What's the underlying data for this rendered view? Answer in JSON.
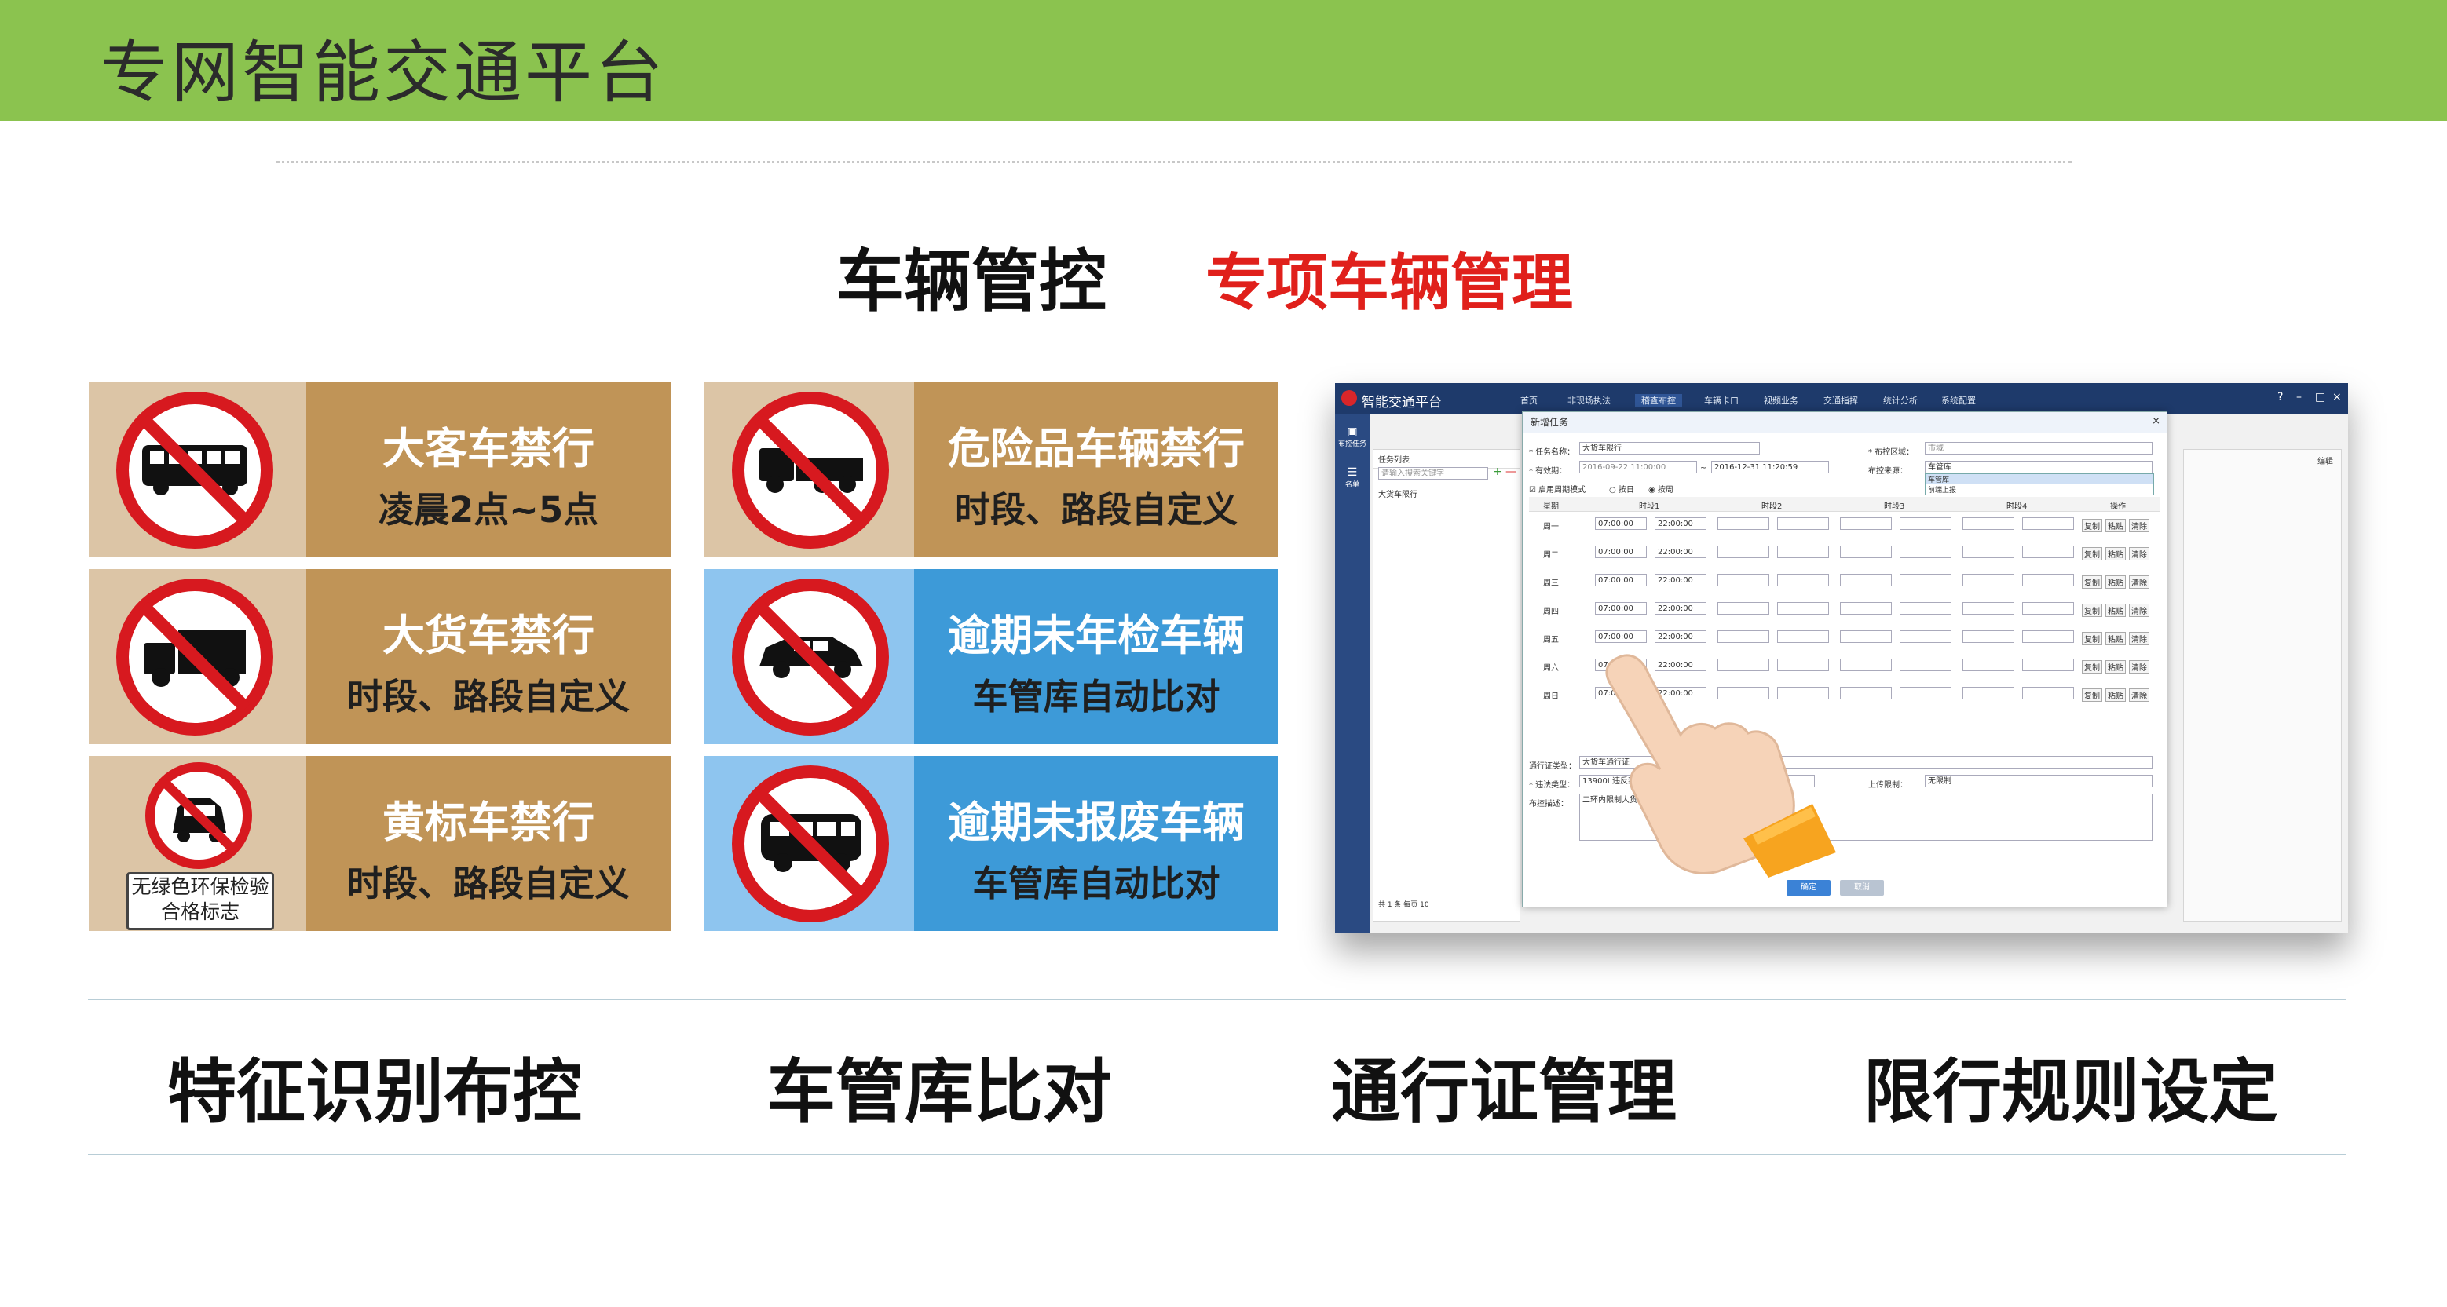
{
  "header": {
    "title": "专网智能交通平台",
    "bar_color": "#8bc34f"
  },
  "section": {
    "title": "车辆管控",
    "subtitle": "专项车辆管理",
    "subtitle_color": "#e0201b"
  },
  "cards": [
    {
      "icon": "no-bus-icon",
      "line1": "大客车禁行",
      "line2": "凌晨2点~5点",
      "theme": "brown"
    },
    {
      "icon": "no-hazmat-truck-icon",
      "line1": "危险品车辆禁行",
      "line2": "时段、路段自定义",
      "theme": "brown"
    },
    {
      "icon": "no-truck-icon",
      "line1": "大货车禁行",
      "line2": "时段、路段自定义",
      "theme": "brown"
    },
    {
      "icon": "no-overdue-inspection-car-icon",
      "line1": "逾期未年检车辆",
      "line2": "车管库自动比对",
      "theme": "blue"
    },
    {
      "icon": "no-yellow-label-car-icon",
      "line1": "黄标车禁行",
      "line2": "时段、路段自定义",
      "theme": "brown",
      "tag": "无绿色环保检验合格标志"
    },
    {
      "icon": "no-unscrapped-bus-icon",
      "line1": "逾期未报废车辆",
      "line2": "车管库自动比对",
      "theme": "blue"
    }
  ],
  "app": {
    "brand": "智能交通平台",
    "nav": [
      "首页",
      "非现场执法",
      "稽查布控",
      "车辆卡口",
      "视频业务",
      "交通指挥",
      "统计分析",
      "系统配置"
    ],
    "left_nav": [
      "布控任务",
      "名单"
    ],
    "list_title": "任务列表",
    "list_search_placeholder": "请输入搜索关键字",
    "list_items": [
      "大货车限行"
    ],
    "pager": "共 1 条  每页 10",
    "right_edit": "编辑",
    "modal": {
      "title": "新增任务",
      "task_name_label": "* 任务名称：",
      "task_name_value": "大货车限行",
      "area_label": "* 布控区域：",
      "area_value": "市域",
      "valid_label": "* 有效期：",
      "valid_from": "2016-09-22 11:00:00",
      "valid_to": "2016-12-31 11:20:59",
      "source_label": "布控来源：",
      "source_options": [
        "车管库",
        "车管库",
        "前端上报"
      ],
      "period_label": "启用周期模式",
      "radio_day": "按日",
      "radio_week": "按周",
      "cols": [
        "星期",
        "时段1",
        "时段2",
        "时段3",
        "时段4",
        "操作"
      ],
      "days": [
        "周一",
        "周二",
        "周三",
        "周四",
        "周五",
        "周六",
        "周日"
      ],
      "slot_start": "07:00:00",
      "slot_end": "22:00:00",
      "row_actions": [
        "复制",
        "粘贴",
        "清除"
      ],
      "permit_label": "通行证类型：",
      "permit_value": "大货车通行证",
      "list_type_label": "* 违法类型：",
      "list_type_value": "13900Ⅰ 违反禁令通行规定",
      "limit_label": "上传限制：",
      "limit_value": "无限制",
      "desc_label": "布控描述：",
      "desc_value": "二环内限制大货车通行",
      "ok": "确定",
      "cancel": "取消"
    }
  },
  "features": [
    "特征识别布控",
    "车管库比对",
    "通行证管理",
    "限行规则设定"
  ]
}
